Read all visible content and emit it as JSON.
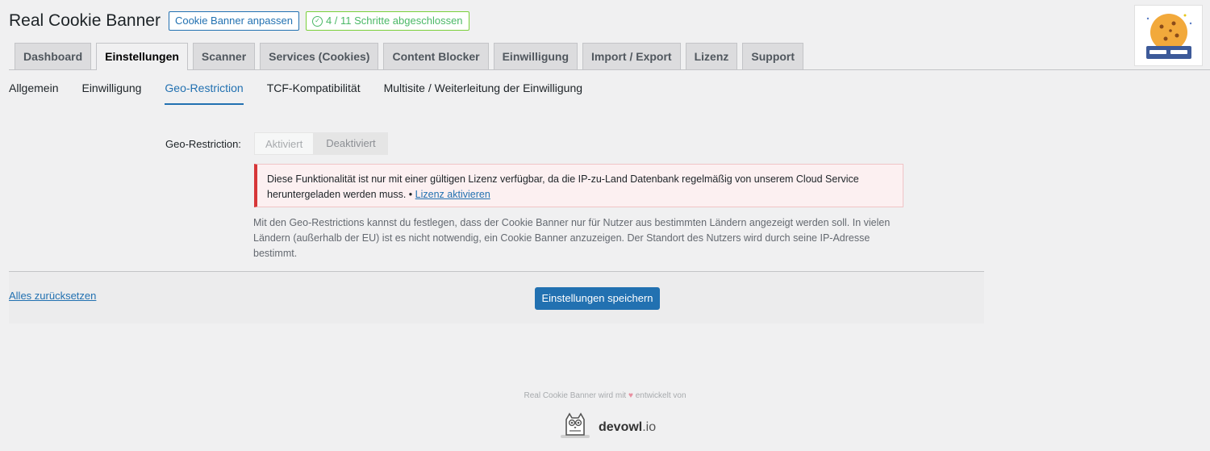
{
  "header": {
    "title": "Real Cookie Banner",
    "customize_label": "Cookie Banner anpassen",
    "steps_label": "4 / 11 Schritte abgeschlossen"
  },
  "tabs": [
    {
      "label": "Dashboard"
    },
    {
      "label": "Einstellungen",
      "active": true
    },
    {
      "label": "Scanner"
    },
    {
      "label": "Services (Cookies)"
    },
    {
      "label": "Content Blocker"
    },
    {
      "label": "Einwilligung"
    },
    {
      "label": "Import / Export"
    },
    {
      "label": "Lizenz"
    },
    {
      "label": "Support"
    }
  ],
  "subtabs": [
    {
      "label": "Allgemein"
    },
    {
      "label": "Einwilligung"
    },
    {
      "label": "Geo-Restriction",
      "active": true
    },
    {
      "label": "TCF-Kompatibilität"
    },
    {
      "label": "Multisite / Weiterleitung der Einwilligung"
    }
  ],
  "geo": {
    "label": "Geo-Restriction:",
    "option_on": "Aktiviert",
    "option_off": "Deaktiviert"
  },
  "notice": {
    "text": "Diese Funktionalität ist nur mit einer gültigen Lizenz verfügbar, da die IP-zu-Land Datenbank regelmäßig von unserem Cloud Service heruntergeladen werden muss. •",
    "link": "Lizenz aktivieren"
  },
  "description": "Mit den Geo-Restrictions kannst du festlegen, dass der Cookie Banner nur für Nutzer aus bestimmten Ländern angezeigt werden soll. In vielen Ländern (außerhalb der EU) ist es nicht notwendig, ein Cookie Banner anzuzeigen. Der Standort des Nutzers wird durch seine IP-Adresse bestimmt.",
  "footer": {
    "reset_label": "Alles zurücksetzen",
    "save_label": "Einstellungen speichern"
  },
  "credit": {
    "before": "Real Cookie Banner wird mit",
    "heart": "♥",
    "after": "entwickelt von",
    "brand": "devowl",
    "brand_suffix": ".io"
  },
  "colors": {
    "accent": "#2271b1",
    "success": "#4ab866",
    "error": "#d63638"
  }
}
